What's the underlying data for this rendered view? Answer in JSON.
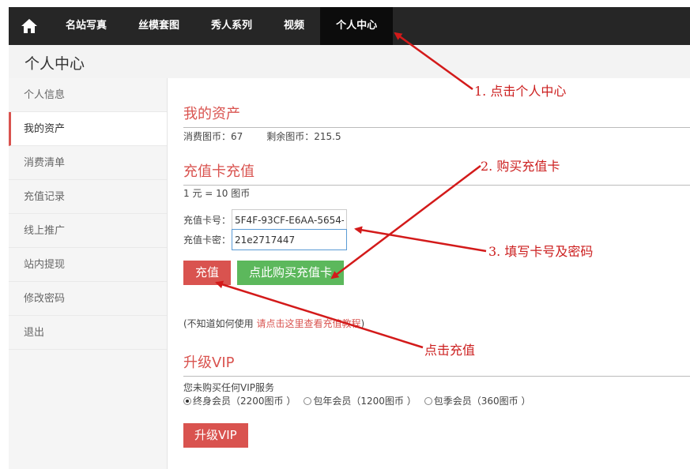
{
  "nav": {
    "items": [
      "名站写真",
      "丝模套图",
      "秀人系列",
      "视频",
      "个人中心"
    ]
  },
  "page_title": "个人中心",
  "sidebar": {
    "items": [
      "个人信息",
      "我的资产",
      "消费清单",
      "充值记录",
      "线上推广",
      "站内提现",
      "修改密码",
      "退出"
    ]
  },
  "assets": {
    "title": "我的资产",
    "spent_label": "消费图币：67",
    "remaining_label": "剩余图币：215.5"
  },
  "recharge": {
    "title": "充值卡充值",
    "rate": "1 元 = 10 图币",
    "card_no_label": "充值卡号：",
    "card_no_value": "5F4F-93CF-E6AA-5654-",
    "card_pwd_label": "充值卡密：",
    "card_pwd_value": "21e2717447",
    "submit_label": "充值",
    "buy_label": "点此购买充值卡",
    "help_prefix": "(不知道如何使用 ",
    "help_link": "请点击这里查看充值教程",
    "help_suffix": ")"
  },
  "vip": {
    "title": "升级VIP",
    "status": "您未购买任何VIP服务",
    "options": [
      "终身会员（2200图币 ）",
      "包年会员（1200图币 ）",
      "包季会员（360图币 ）"
    ],
    "selected": 0,
    "button_label": "升级VIP"
  },
  "annotations": {
    "note1": "1. 点击个人中心",
    "note2": "2. 购买充值卡",
    "note3": "3. 填写卡号及密码",
    "note4": "点击充值",
    "color": "#cc1f1f"
  },
  "colors": {
    "accent_red": "#d9534f",
    "green": "#5cb85c",
    "topbar": "#262626"
  }
}
